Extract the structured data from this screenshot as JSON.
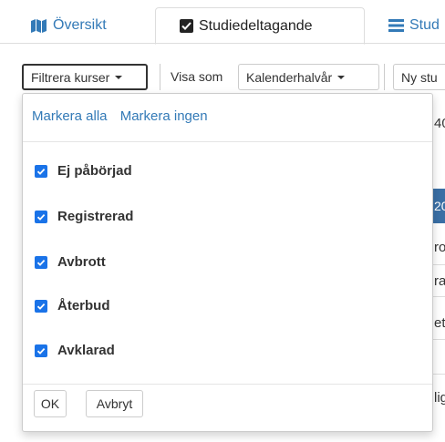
{
  "tabs": {
    "overview_label": "Översikt",
    "studie_label": "Studiedeltagande",
    "third_label": "Stud"
  },
  "toolbar": {
    "filter_label": "Filtrera kurser",
    "visa_label": "Visa som",
    "halvar_label": "Kalenderhalvår",
    "ny_label": "Ny stu"
  },
  "background": {
    "frag1": "40",
    "frag2": "20",
    "frag3": "ro",
    "frag4": "ra",
    "frag5": "et",
    "frag6": "lig"
  },
  "dropdown": {
    "select_all": "Markera alla",
    "select_none": "Markera ingen",
    "items": [
      {
        "label": "Ej påbörjad",
        "checked": true
      },
      {
        "label": "Registrerad",
        "checked": true
      },
      {
        "label": "Avbrott",
        "checked": true
      },
      {
        "label": "Återbud",
        "checked": true
      },
      {
        "label": "Avklarad",
        "checked": true
      }
    ],
    "ok_label": "OK",
    "cancel_label": "Avbryt"
  },
  "colors": {
    "link": "#337ab7",
    "checkbox": "#1a73e8"
  }
}
